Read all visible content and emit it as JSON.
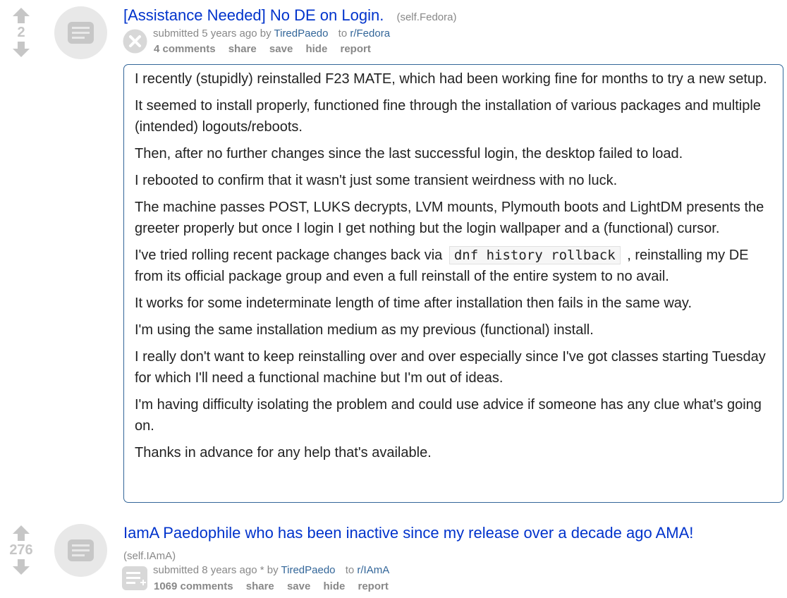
{
  "posts": [
    {
      "score": "2",
      "title": "[Assistance Needed] No DE on Login.",
      "domain": "(self.Fedora)",
      "submitted": "submitted 5 years ago by",
      "author": "TiredPaedo",
      "to": "to",
      "subreddit": "r/Fedora",
      "comments": "4 comments",
      "share": "share",
      "save": "save",
      "hide": "hide",
      "report": "report",
      "expando_icon": "close-circle-icon",
      "selftext": {
        "p1": "I recently (stupidly) reinstalled F23 MATE, which had been working fine for months to try a new setup.",
        "p2": "It seemed to install properly, functioned fine through the installation of various packages and multiple (intended) logouts/reboots.",
        "p3": "Then, after no further changes since the last successful login, the desktop failed to load.",
        "p4": "I rebooted to confirm that it wasn't just some transient weirdness with no luck.",
        "p5": "The machine passes POST, LUKS decrypts, LVM mounts, Plymouth boots and LightDM presents the greeter properly but once I login I get nothing but the login wallpaper and a (functional) cursor.",
        "p6_before": "I've tried rolling recent package changes back via",
        "p6_code": "dnf history rollback",
        "p6_after": ", reinstalling my DE from its official package group and even a full reinstall of the entire system to no avail.",
        "p7": "It works for some indeterminate length of time after installation then fails in the same way.",
        "p8": "I'm using the same installation medium as my previous (functional) install.",
        "p9": "I really don't want to keep reinstalling over and over especially since I've got classes starting Tuesday for which I'll need a functional machine but I'm out of ideas.",
        "p10": "I'm having difficulty isolating the problem and could use advice if someone has any clue what's going on.",
        "p11": "Thanks in advance for any help that's available."
      }
    },
    {
      "score": "276",
      "title": "IamA Paedophile who has been inactive since my release over a decade ago AMA!",
      "domain": "(self.IAmA)",
      "submitted": "submitted 8 years ago * by",
      "author": "TiredPaedo",
      "to": "to",
      "subreddit": "r/IAmA",
      "comments": "1069 comments",
      "share": "share",
      "save": "save",
      "hide": "hide",
      "report": "report",
      "expando_icon": "expand-text-icon"
    }
  ],
  "colors": {
    "link": "#0033cc",
    "meta": "#888888",
    "author": "#336699",
    "score": "#c6c6c6",
    "thumb": "#e8e8e8"
  }
}
